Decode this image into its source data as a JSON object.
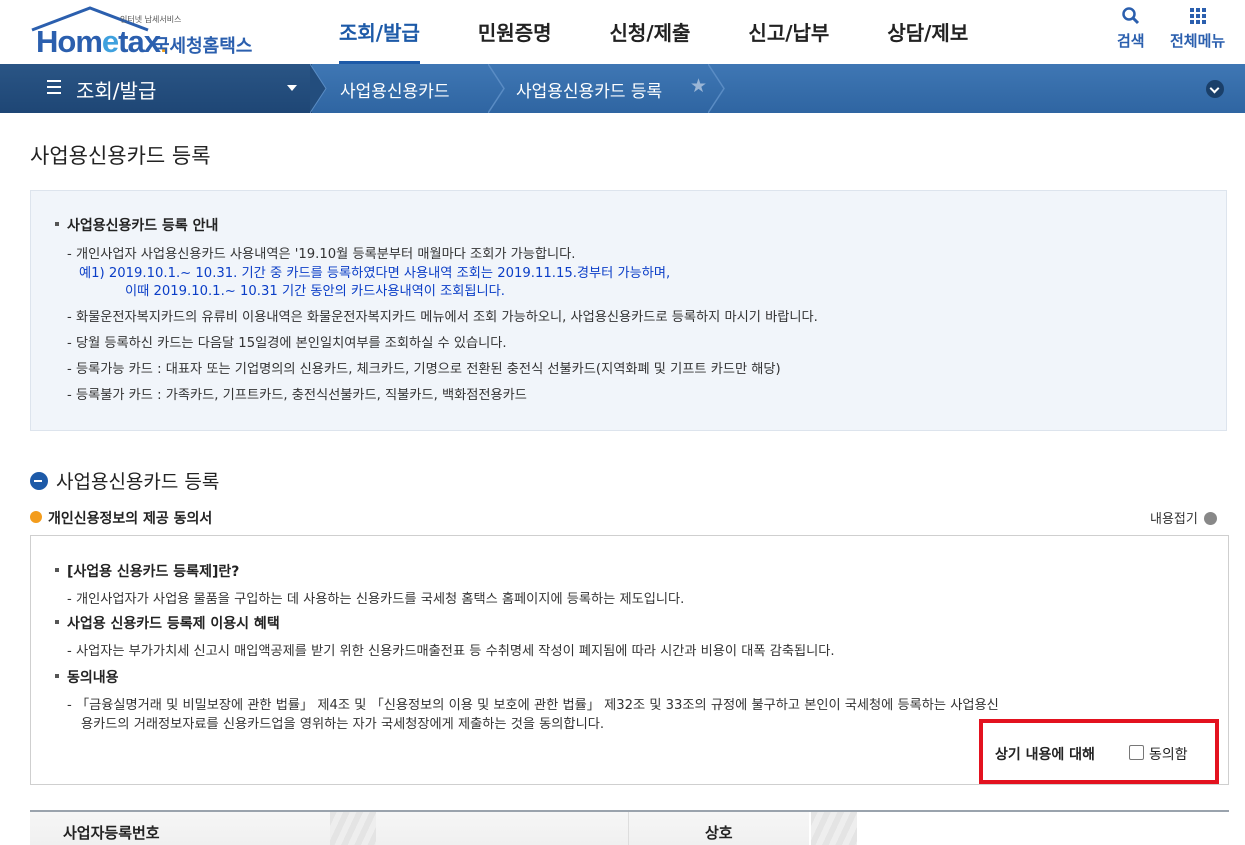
{
  "header": {
    "logo_sub": "인터넷 납세서비스",
    "logo_main_a": "Hom",
    "logo_main_e": "e",
    "logo_main_b": "tax",
    "logo_dot": ".",
    "logo_kr": "국세청홈택스",
    "gnb": [
      "조회/발급",
      "민원증명",
      "신청/제출",
      "신고/납부",
      "상담/제보"
    ],
    "search_label": "검색",
    "all_menu_label": "전체메뉴",
    "brand_color": "#1d5aa8"
  },
  "breadcrumb": {
    "menu_title": "조회/발급",
    "level1": "사업용신용카드",
    "level2": "사업용신용카드 등록"
  },
  "page_title": "사업용신용카드 등록",
  "guide": {
    "heading": "사업용신용카드 등록 안내",
    "lines": [
      "- 개인사업자 사업용신용카드 사용내역은 '19.10월 등록분부터 매월마다 조회가 가능합니다.",
      "예1) 2019.10.1.~ 10.31. 기간 중 카드를 등록하였다면 사용내역 조회는 2019.11.15.경부터 가능하며,",
      "이때 2019.10.1.~ 10.31 기간 동안의 카드사용내역이 조회됩니다.",
      "- 화물운전자복지카드의 유류비 이용내역은 화물운전자복지카드 메뉴에서 조회 가능하오니, 사업용신용카드로 등록하지 마시기 바랍니다.",
      "- 당월 등록하신 카드는 다음달 15일경에 본인일치여부를 조회하실 수 있습니다.",
      "- 등록가능 카드 : 대표자 또는 기업명의의 신용카드, 체크카드, 기명으로 전환된 충전식 선불카드(지역화폐 및 기프트 카드만 해당)",
      "- 등록불가 카드 : 가족카드, 기프트카드, 충전식선불카드, 직불카드, 백화점전용카드"
    ]
  },
  "section": {
    "title": "사업용신용카드 등록",
    "subtitle": "개인신용정보의 제공 동의서",
    "collapse_label": "내용접기"
  },
  "consent": {
    "h1": "[사업용 신용카드 등록제]란?",
    "l1": "- 개인사업자가 사업용 물품을 구입하는 데 사용하는 신용카드를 국세청 홈택스 홈페이지에 등록하는 제도입니다.",
    "h2": "사업용 신용카드 등록제 이용시 혜택",
    "l2": "- 사업자는 부가가치세 신고시 매입액공제를 받기 위한 신용카드매출전표 등 수취명세 작성이 폐지됨에 따라 시간과 비용이 대폭 감축됩니다.",
    "h3": "동의내용",
    "l3a": "- 「금융실명거래 및 비밀보장에 관한 법률」 제4조 및 「신용정보의 이용 및 보호에 관한 법률」 제32조 및 33조의 규정에 불구하고 본인이 국세청에 등록하는 사업용신",
    "l3b": "용카드의    거래정보자료를 신용카드업을 영위하는 자가 국세청장에게 제출하는 것을 동의합니다.",
    "agree_prefix": "상기 내용에 대해",
    "agree_label": "동의함",
    "agree_checked": false,
    "highlight_color": "#e3121f"
  },
  "table": {
    "col1": "사업자등록번호",
    "col2": "상호"
  }
}
